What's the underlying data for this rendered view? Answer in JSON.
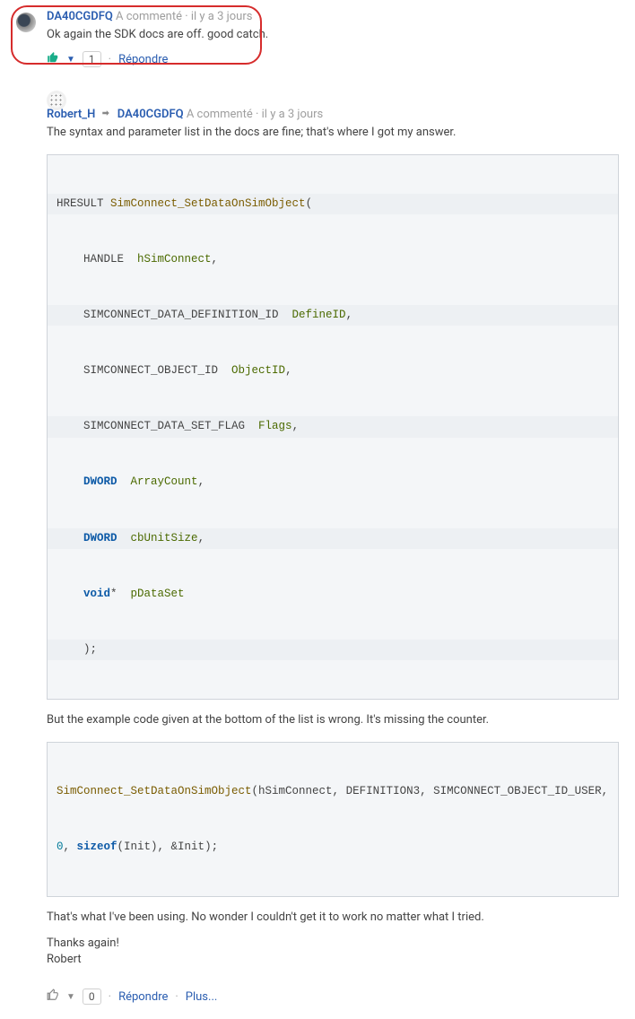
{
  "post1": {
    "user": "DA40CGDFQ",
    "action": "A commenté",
    "sep": "·",
    "time": "il y a 3 jours",
    "body": "Ok again the SDK docs are off. good catch.",
    "vote": "1",
    "reply": "Répondre"
  },
  "post2": {
    "user": "Robert_H",
    "reply_to": "DA40CGDFQ",
    "action": "A commenté",
    "sep": "·",
    "time": "il y a 3 jours",
    "intro": "The syntax and parameter list in the docs are fine; that's where I got my answer.",
    "code1": {
      "l1a": "HRESULT ",
      "l1b": "SimConnect_SetDataOnSimObject",
      "l1c": "(",
      "l2a": "    HANDLE  ",
      "l2b": "hSimConnect",
      "l2c": ",",
      "l3a": "    SIMCONNECT_DATA_DEFINITION_ID  ",
      "l3b": "DefineID",
      "l3c": ",",
      "l4a": "    SIMCONNECT_OBJECT_ID  ",
      "l4b": "ObjectID",
      "l4c": ",",
      "l5a": "    SIMCONNECT_DATA_SET_FLAG  ",
      "l5b": "Flags",
      "l5c": ",",
      "l6a": "    ",
      "l6b": "DWORD",
      "l6c": "  ",
      "l6d": "ArrayCount",
      "l6e": ",",
      "l7a": "    ",
      "l7b": "DWORD",
      "l7c": "  ",
      "l7d": "cbUnitSize",
      "l7e": ",",
      "l8a": "    ",
      "l8b": "void",
      "l8c": "*  ",
      "l8d": "pDataSet",
      "l9": "    );"
    },
    "mid": "But the example code given at the bottom of the list is wrong. It's missing the counter.",
    "code2": {
      "l1a": "SimConnect_SetDataOnSimObject",
      "l1b": "(hSimConnect, DEFINITION3, SIMCONNECT_OBJECT_ID_USER,",
      "l2a": "0",
      "l2b": ", ",
      "l2c": "sizeof",
      "l2d": "(Init), &Init);"
    },
    "p3": "That's what I've been using. No wonder I couldn't get it to work no matter what I tried.",
    "p4a": "Thanks again!",
    "p4b": "Robert",
    "vote": "0",
    "reply": "Répondre",
    "more": "Plus..."
  }
}
